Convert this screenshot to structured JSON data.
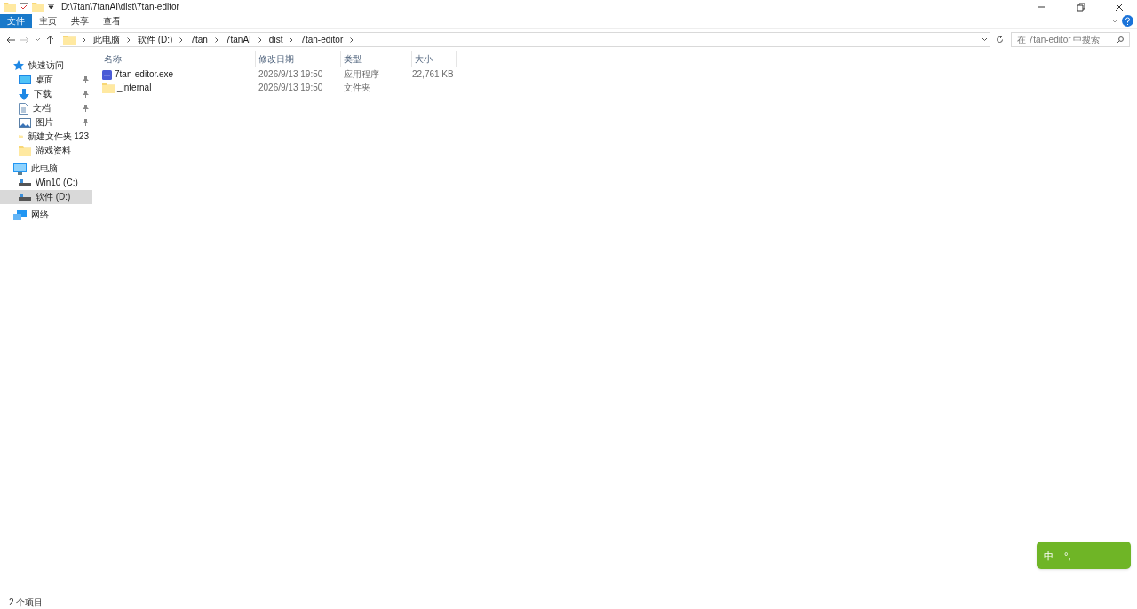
{
  "window": {
    "title": "D:\\7tan\\7tanAI\\dist\\7tan-editor"
  },
  "ribbon_tabs": [
    {
      "label": "文件",
      "selected": true
    },
    {
      "label": "主页",
      "selected": false
    },
    {
      "label": "共享",
      "selected": false
    },
    {
      "label": "查看",
      "selected": false
    }
  ],
  "breadcrumb": [
    "此电脑",
    "软件 (D:)",
    "7tan",
    "7tanAI",
    "dist",
    "7tan-editor"
  ],
  "search": {
    "placeholder": "在 7tan-editor 中搜索"
  },
  "sidebar": {
    "items": [
      {
        "label": "快速访问",
        "kind": "star",
        "selected": false,
        "children": [
          {
            "label": "桌面",
            "kind": "desktop",
            "pinned": true,
            "selected": false
          },
          {
            "label": "下载",
            "kind": "download",
            "pinned": true,
            "selected": false
          },
          {
            "label": "文档",
            "kind": "document",
            "pinned": true,
            "selected": false
          },
          {
            "label": "图片",
            "kind": "picture",
            "pinned": true,
            "selected": false
          },
          {
            "label": "新建文件夹 123",
            "kind": "folder",
            "pinned": false,
            "selected": false
          },
          {
            "label": "游戏资料",
            "kind": "folder",
            "pinned": false,
            "selected": false
          }
        ]
      },
      {
        "label": "此电脑",
        "kind": "computer",
        "selected": false,
        "children": [
          {
            "label": "Win10 (C:)",
            "kind": "drive",
            "pinned": false,
            "selected": false
          },
          {
            "label": "软件 (D:)",
            "kind": "drive",
            "pinned": false,
            "selected": true
          }
        ]
      },
      {
        "label": "网络",
        "kind": "network",
        "selected": false
      }
    ]
  },
  "table": {
    "columns": [
      "名称",
      "修改日期",
      "类型",
      "大小"
    ],
    "rows": [
      {
        "kind": "app",
        "name": "7tan-editor.exe",
        "modified": "2026/9/13 19:50",
        "type": "应用程序",
        "size": "22,761 KB"
      },
      {
        "kind": "folder",
        "name": "_internal",
        "modified": "2026/9/13 19:50",
        "type": "文件夹"
      }
    ]
  },
  "ime": {
    "mode": "中",
    "punct": "°,"
  },
  "status_bar": {
    "count": "2 个项目"
  }
}
